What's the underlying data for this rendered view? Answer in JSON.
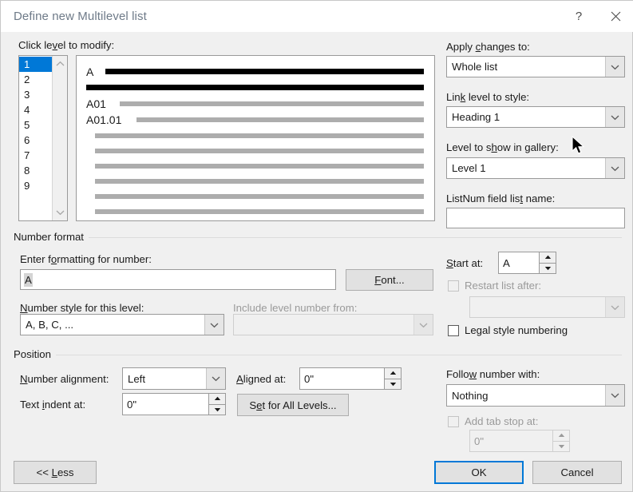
{
  "window": {
    "title": "Define new Multilevel list",
    "help_icon": "help-question-icon",
    "close_icon": "close-x-icon"
  },
  "level_list": {
    "label": "Click level to modify:",
    "items": [
      "1",
      "2",
      "3",
      "4",
      "5",
      "6",
      "7",
      "8",
      "9"
    ],
    "selected": "1",
    "scroll_up_icon": "chevron-up-icon",
    "scroll_down_icon": "chevron-down-icon"
  },
  "preview": {
    "rows": [
      {
        "number": "A",
        "bar_color": "black"
      },
      {
        "number": "",
        "bar_color": "black"
      },
      {
        "number": "A01",
        "bar_color": "gray"
      },
      {
        "number": "A01.01",
        "bar_color": "gray"
      },
      {
        "number": "",
        "bar_color": "gray"
      },
      {
        "number": "",
        "bar_color": "gray"
      },
      {
        "number": "",
        "bar_color": "gray"
      },
      {
        "number": "",
        "bar_color": "gray"
      },
      {
        "number": "",
        "bar_color": "gray"
      },
      {
        "number": "",
        "bar_color": "gray"
      }
    ]
  },
  "apply_changes": {
    "label": "Apply changes to:",
    "value": "Whole list"
  },
  "link_level": {
    "label": "Link level to style:",
    "value": "Heading 1"
  },
  "gallery_level": {
    "label": "Level to show in gallery:",
    "value": "Level 1"
  },
  "listnum_field": {
    "label": "ListNum field list name:",
    "value": ""
  },
  "number_format": {
    "group_label": "Number format",
    "enter_formatting_label": "Enter formatting for number:",
    "enter_formatting_value": "A",
    "font_button": "Font...",
    "number_style_label": "Number style for this level:",
    "number_style_value": "A, B, C, ...",
    "include_level_label": "Include level number from:",
    "include_level_value": "",
    "start_at_label": "Start at:",
    "start_at_value": "A",
    "restart_label": "Restart list after:",
    "restart_value": "",
    "legal_style_label": "Legal style numbering"
  },
  "position": {
    "group_label": "Position",
    "number_alignment_label": "Number alignment:",
    "number_alignment_value": "Left",
    "aligned_at_label": "Aligned at:",
    "aligned_at_value": "0\"",
    "text_indent_label": "Text indent at:",
    "text_indent_value": "0\"",
    "set_all_levels_button": "Set for All Levels...",
    "follow_number_label": "Follow number with:",
    "follow_number_value": "Nothing",
    "add_tab_stop_label": "Add tab stop at:",
    "add_tab_stop_value": "0\""
  },
  "footer": {
    "less_button": "<< Less",
    "ok_button": "OK",
    "cancel_button": "Cancel"
  },
  "colors": {
    "selection_blue": "#0078d7",
    "dialog_bg": "#f0f0f0",
    "preview_bar_gray": "#adadad"
  }
}
